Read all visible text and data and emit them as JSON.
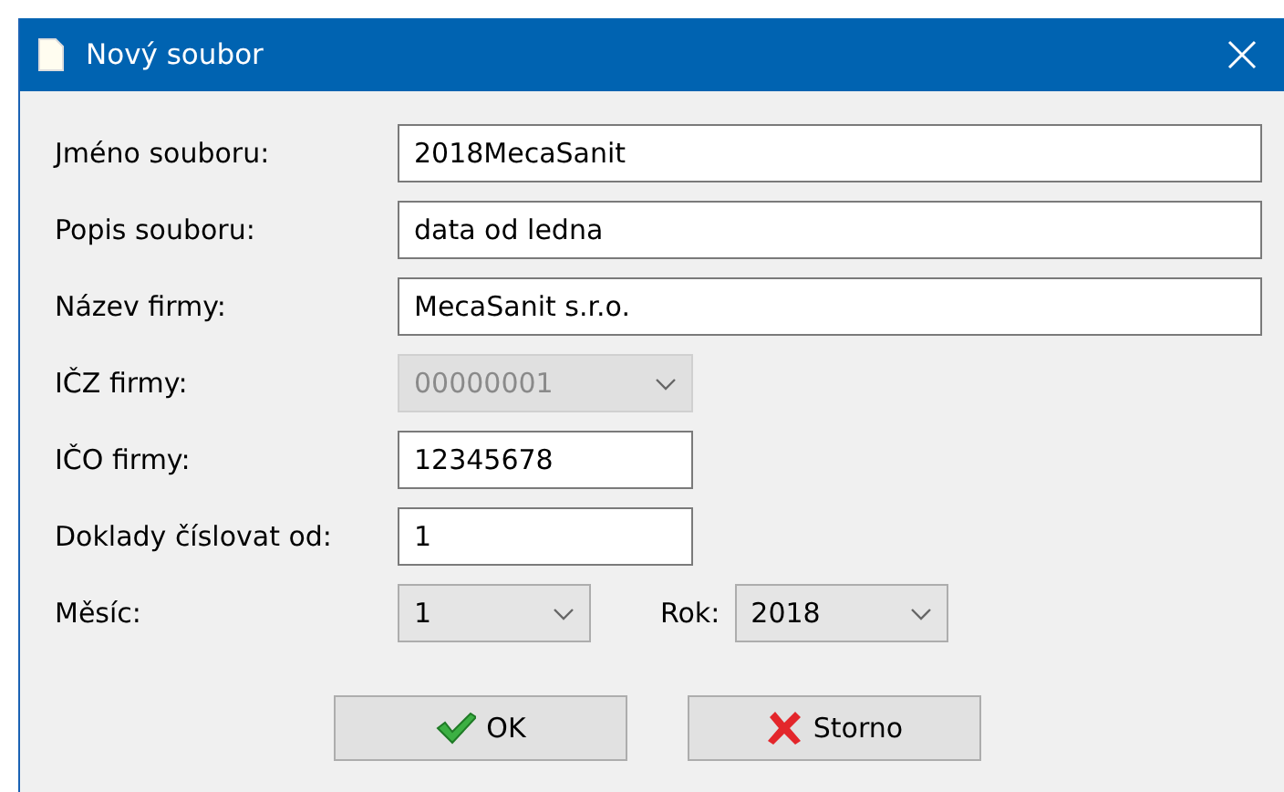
{
  "window": {
    "title": "Nový soubor"
  },
  "fields": [
    {
      "label": "Jméno souboru:",
      "kind": "text-wide",
      "value": "2018MecaSanit",
      "disabled": false
    },
    {
      "label": "Popis souboru:",
      "kind": "text-wide",
      "value": "data od ledna",
      "disabled": false
    },
    {
      "label": "Název firmy:",
      "kind": "text-wide",
      "value": "MecaSanit s.r.o.",
      "disabled": false
    },
    {
      "label": "IČZ firmy:",
      "kind": "combo",
      "value": "00000001",
      "disabled": true
    },
    {
      "label": "IČO firmy:",
      "kind": "text",
      "value": "12345678",
      "disabled": false
    },
    {
      "label": "Doklady číslovat od:",
      "kind": "text",
      "value": "1",
      "disabled": false
    }
  ],
  "period": {
    "month_label": "Měsíc:",
    "month": "1",
    "year_label": "Rok:",
    "year": "2018"
  },
  "buttons": [
    {
      "label": "OK",
      "kind": "ok"
    },
    {
      "label": "Storno",
      "kind": "cancel"
    }
  ]
}
